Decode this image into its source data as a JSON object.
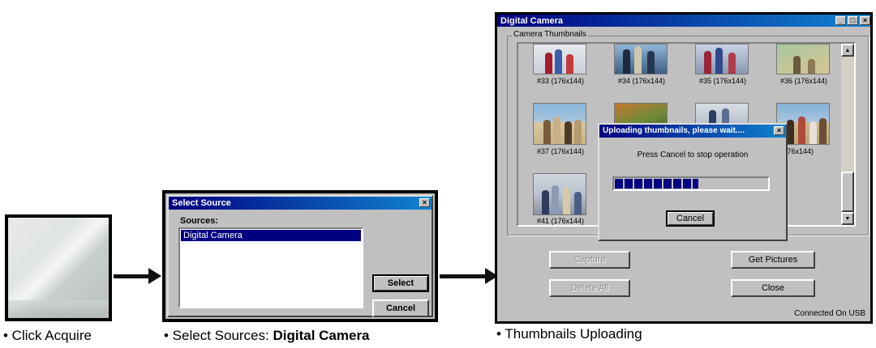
{
  "captions": {
    "acquire": "• Click Acquire",
    "select_prefix": "• Select Sources: ",
    "select_bold": "Digital Camera",
    "uploading": "• Thumbnails Uploading"
  },
  "select_source": {
    "title": "Select Source",
    "close_glyph": "×",
    "sources_label": "Sources:",
    "sources": [
      "Digital Camera"
    ],
    "selected_index": 0,
    "select_button": "Select",
    "cancel_button": "Cancel"
  },
  "camera": {
    "title": "Digital Camera",
    "group_label": "Camera Thumbnails",
    "thumbnails": [
      "#33 (176x144)",
      "#34 (176x144)",
      "#35 (176x144)",
      "#36 (176x144)",
      "#37 (176x144)",
      "0 (176x144)",
      "#41 (176x144)"
    ],
    "buttons": {
      "capture": "Capture",
      "delete_all": "Delete All",
      "get_pictures": "Get Pictures",
      "close": "Close"
    },
    "status": "Connected On USB"
  },
  "upload_dialog": {
    "title": "Uploading thumbnails, please wait....",
    "close_glyph": "×",
    "message": "Press Cancel to stop operation",
    "progress": 0.55,
    "cancel_button": "Cancel"
  },
  "colors": {
    "titlebar": "#000080",
    "selection": "#000080",
    "progress": "#000080"
  }
}
